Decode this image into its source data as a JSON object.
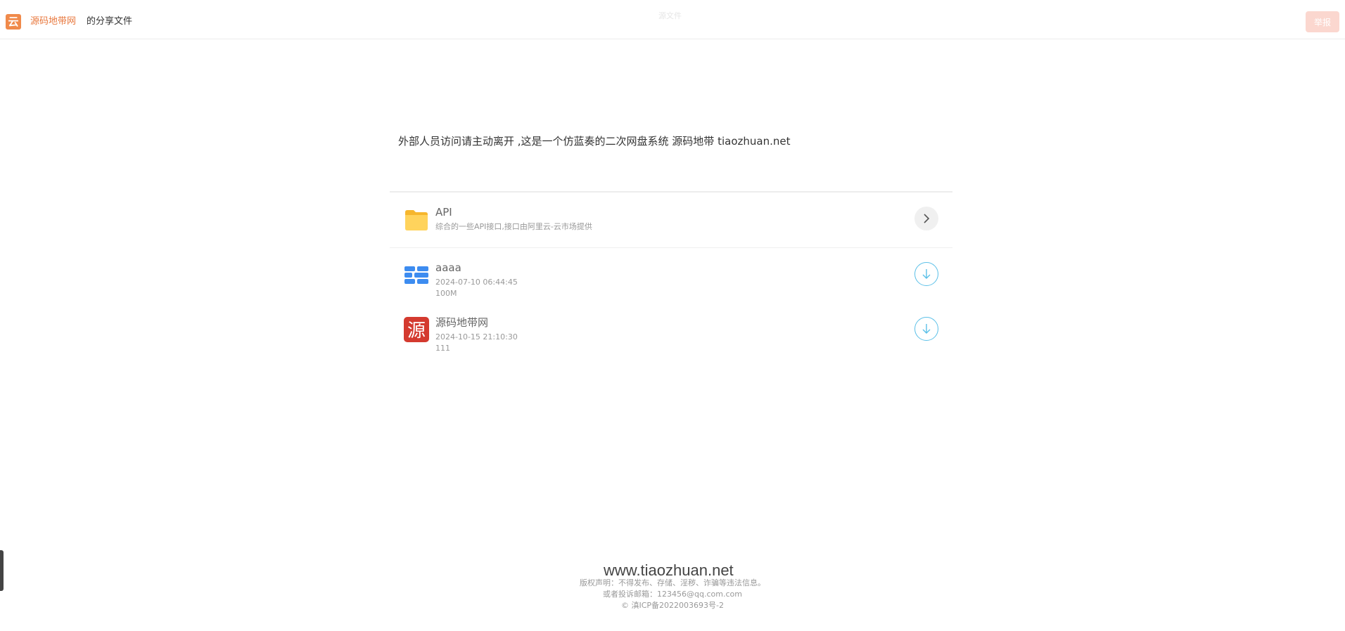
{
  "header": {
    "logo_glyph": "云",
    "site_name": "源码地带网",
    "share_label": "的分享文件",
    "center_title": "源文件",
    "report_label": "举报"
  },
  "notice": "外部人员访问请主动离开 ,这是一个仿蓝奏的二次网盘系统 源码地带 tiaozhuan.net",
  "items": [
    {
      "type": "folder",
      "name": "API",
      "description": "综合的一些API接口,接口由阿里云-云市场提供",
      "icon": "folder-icon"
    },
    {
      "type": "file",
      "name": "aaaa",
      "date": "2024-07-10 06:44:45",
      "size": "100M",
      "icon": "file-blocks-icon"
    },
    {
      "type": "file",
      "name": "源码地带网",
      "date": "2024-10-15 21:10:30",
      "size": "111",
      "icon": "yuan-logo-icon",
      "icon_glyph": "源"
    }
  ],
  "watermark": "www.tiaozhuan.net",
  "footer": {
    "line1": "版权声明：不得发布、存储、淫秽、诈骗等违法信息。",
    "line2": "或者投诉邮箱：123456@qq.com.com",
    "line3": "© 滇ICP备2022003693号-2"
  },
  "colors": {
    "brand": "#e8773c",
    "logo_bg": "#f08a4b",
    "report_bg": "#fbd7cf",
    "download_accent": "#5bc0e8",
    "folder": "#ffc83d"
  }
}
